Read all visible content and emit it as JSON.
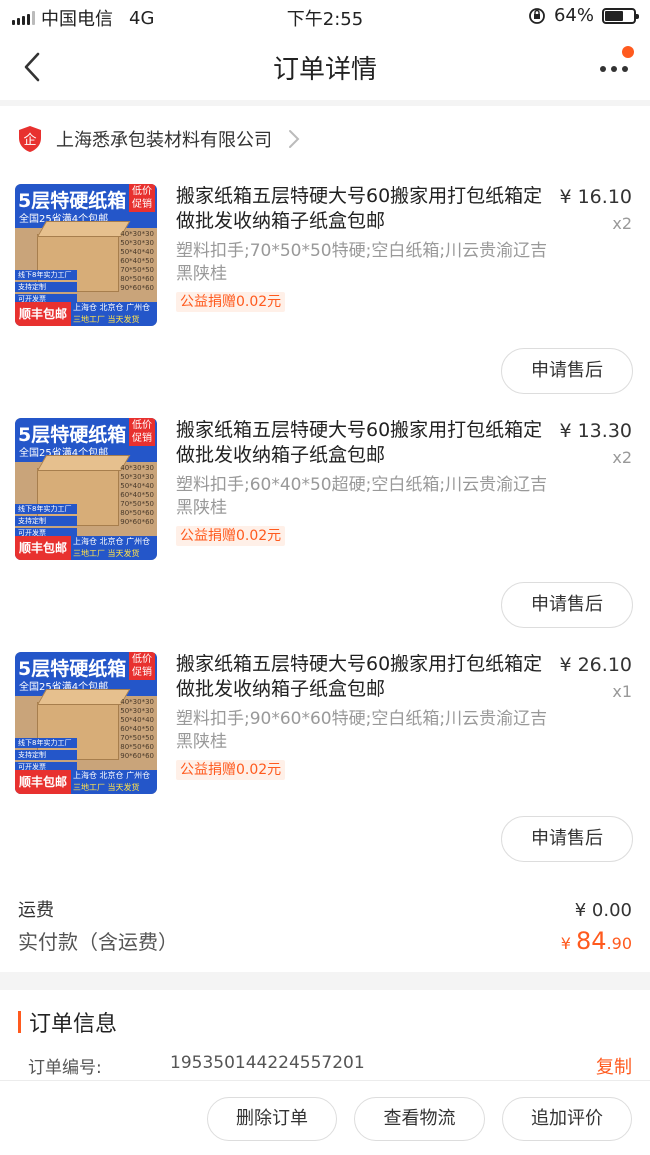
{
  "status_bar": {
    "carrier": "中国电信",
    "network": "4G",
    "time": "下午2:55",
    "battery": "64%",
    "battery_level": 0.64
  },
  "nav": {
    "title": "订单详情",
    "back_icon": "chevron-left-icon",
    "more_icon": "more-dots-icon"
  },
  "shop": {
    "name": "上海悉承包装材料有限公司",
    "icon": "enterprise-shield-icon",
    "icon_char": "企"
  },
  "thumb_text": {
    "headline": "5层特硬纸箱",
    "tag": "低价促销",
    "sub": "全国25省满4个包邮",
    "sizes": [
      "40*30*30",
      "50*30*30",
      "50*40*40",
      "60*40*50",
      "70*50*50",
      "80*50*60",
      "90*60*60"
    ],
    "side_tags": [
      "线下8年实力工厂",
      "支持定制",
      "可开发票"
    ],
    "foot_left": "顺丰包邮",
    "foot_wh": "上海仓 北京仓 广州仓",
    "foot_wh2": "三地工厂 当天发货"
  },
  "items": [
    {
      "name": "搬家纸箱五层特硬大号60搬家用打包纸箱定做批发收纳箱子纸盒包邮",
      "price": "¥ 16.10",
      "qty": "x2",
      "spec": "塑料扣手;70*50*50特硬;空白纸箱;川云贵渝辽吉黑陕桂",
      "donate": "公益捐赠0.02元",
      "after_sale": "申请售后"
    },
    {
      "name": "搬家纸箱五层特硬大号60搬家用打包纸箱定做批发收纳箱子纸盒包邮",
      "price": "¥ 13.30",
      "qty": "x2",
      "spec": "塑料扣手;60*40*50超硬;空白纸箱;川云贵渝辽吉黑陕桂",
      "donate": "公益捐赠0.02元",
      "after_sale": "申请售后"
    },
    {
      "name": "搬家纸箱五层特硬大号60搬家用打包纸箱定做批发收纳箱子纸盒包邮",
      "price": "¥ 26.10",
      "qty": "x1",
      "spec": "塑料扣手;90*60*60特硬;空白纸箱;川云贵渝辽吉黑陕桂",
      "donate": "公益捐赠0.02元",
      "after_sale": "申请售后"
    }
  ],
  "summary": {
    "shipping_label": "运费",
    "shipping_value": "¥ 0.00",
    "total_label": "实付款（含运费）",
    "total_currency": "¥ ",
    "total_int": "84",
    "total_dec": ".90"
  },
  "order_info": {
    "title": "订单信息",
    "order_no_label": "订单编号:",
    "order_no": "195350144224557201",
    "copy": "复制"
  },
  "actions": {
    "delete": "删除订单",
    "logistics": "查看物流",
    "review": "追加评价"
  },
  "colors": {
    "accent": "#ff5a1e",
    "shop_icon": "#e8312f",
    "thumb_blue": "#2456c9"
  }
}
